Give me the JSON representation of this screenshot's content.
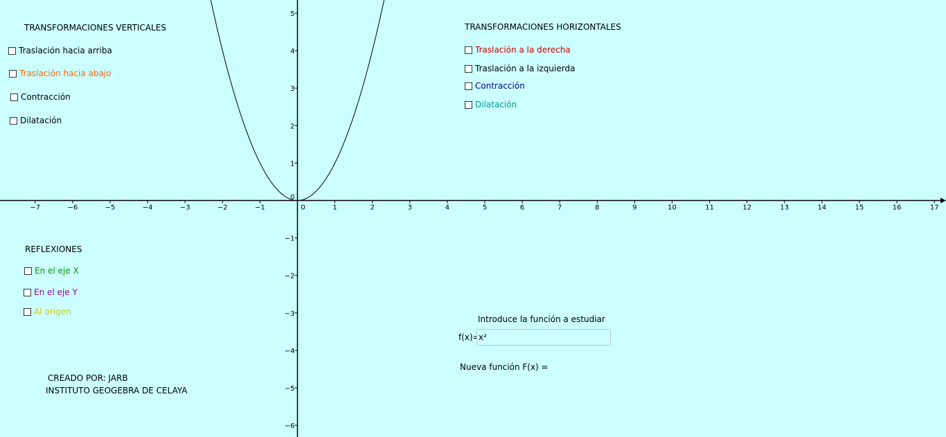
{
  "vertical": {
    "title": "TRANSFORMACIONES VERTICALES",
    "items": [
      {
        "label": "Traslación hacia arriba",
        "color": "#000000"
      },
      {
        "label": "Traslación hacia abajo",
        "color": "#ff6600"
      },
      {
        "label": "Contracción",
        "color": "#000000"
      },
      {
        "label": "Dilatación",
        "color": "#000000"
      }
    ]
  },
  "horizontal": {
    "title": "TRANSFORMACIONES HORIZONTALES",
    "items": [
      {
        "label": "Traslación a la derecha",
        "color": "#cc0000"
      },
      {
        "label": "Traslación a la izquierda",
        "color": "#000000"
      },
      {
        "label": "Contracción",
        "color": "#000099"
      },
      {
        "label": "Dilatación",
        "color": "#009999"
      }
    ]
  },
  "reflections": {
    "title": "REFLEXIONES",
    "items": [
      {
        "label": "En el eje X",
        "color": "#009900"
      },
      {
        "label": "En el eje Y",
        "color": "#990099"
      },
      {
        "label": "Al origen",
        "color": "#cccc00"
      }
    ]
  },
  "credits": {
    "line1": "CREADO POR: JARB",
    "line2": "INSTITUTO GEOGEBRA DE CELAYA"
  },
  "function_input": {
    "prompt": "Introduce la función a estudiar",
    "label": "f(x)=",
    "value": "x²"
  },
  "new_function": {
    "label": "Nueva función F(x) ="
  },
  "graph": {
    "function": "x^2",
    "x_ticks": [
      "−7",
      "−6",
      "−5",
      "−4",
      "−3",
      "−2",
      "−1",
      "0",
      "1",
      "2",
      "3",
      "4",
      "5",
      "6",
      "7",
      "8",
      "9",
      "10",
      "11",
      "12",
      "13",
      "14",
      "15",
      "16",
      "17"
    ],
    "y_ticks": [
      "5",
      "4",
      "3",
      "2",
      "1",
      "0",
      "−1",
      "−2",
      "−3",
      "−4",
      "−5",
      "−6"
    ],
    "background": "#ccffff",
    "curve_color": "#000000"
  }
}
